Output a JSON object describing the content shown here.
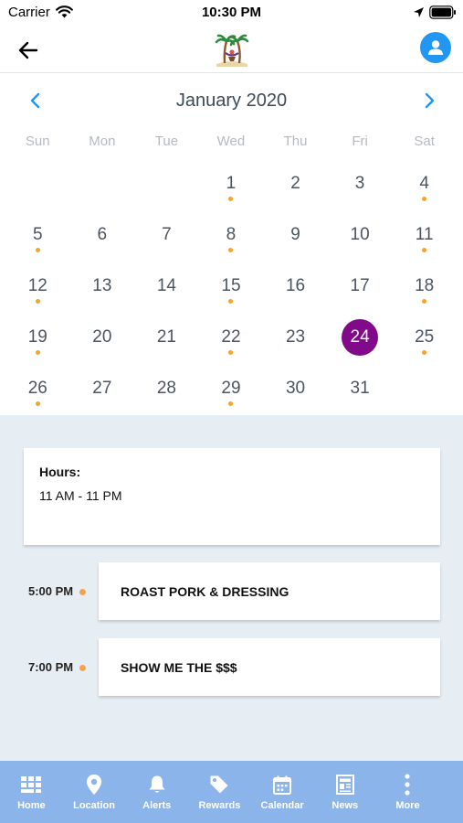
{
  "status_bar": {
    "carrier": "Carrier",
    "time": "10:30 PM"
  },
  "calendar": {
    "month_title": "January 2020",
    "weekdays": [
      "Sun",
      "Mon",
      "Tue",
      "Wed",
      "Thu",
      "Fri",
      "Sat"
    ],
    "weeks": [
      [
        null,
        null,
        null,
        {
          "day": "1",
          "dot": true
        },
        {
          "day": "2",
          "dot": false
        },
        {
          "day": "3",
          "dot": false
        },
        {
          "day": "4",
          "dot": true
        }
      ],
      [
        {
          "day": "5",
          "dot": true
        },
        {
          "day": "6",
          "dot": false
        },
        {
          "day": "7",
          "dot": false
        },
        {
          "day": "8",
          "dot": true
        },
        {
          "day": "9",
          "dot": false
        },
        {
          "day": "10",
          "dot": false
        },
        {
          "day": "11",
          "dot": true
        }
      ],
      [
        {
          "day": "12",
          "dot": true
        },
        {
          "day": "13",
          "dot": false
        },
        {
          "day": "14",
          "dot": false
        },
        {
          "day": "15",
          "dot": true
        },
        {
          "day": "16",
          "dot": false
        },
        {
          "day": "17",
          "dot": false
        },
        {
          "day": "18",
          "dot": true
        }
      ],
      [
        {
          "day": "19",
          "dot": true
        },
        {
          "day": "20",
          "dot": false
        },
        {
          "day": "21",
          "dot": false
        },
        {
          "day": "22",
          "dot": true
        },
        {
          "day": "23",
          "dot": false
        },
        {
          "day": "24",
          "dot": false,
          "selected": true
        },
        {
          "day": "25",
          "dot": true
        }
      ],
      [
        {
          "day": "26",
          "dot": true
        },
        {
          "day": "27",
          "dot": false
        },
        {
          "day": "28",
          "dot": false
        },
        {
          "day": "29",
          "dot": true
        },
        {
          "day": "30",
          "dot": false
        },
        {
          "day": "31",
          "dot": false
        },
        null
      ]
    ],
    "selected_day": "24"
  },
  "hours": {
    "label": "Hours:",
    "value": "11 AM - 11 PM"
  },
  "events": [
    {
      "time": "5:00 PM",
      "title": "ROAST PORK & DRESSING"
    },
    {
      "time": "7:00 PM",
      "title": "SHOW ME THE $$$"
    }
  ],
  "tab_bar": {
    "items": [
      {
        "label": "Home",
        "icon": "grid-icon"
      },
      {
        "label": "Location",
        "icon": "map-pin-icon"
      },
      {
        "label": "Alerts",
        "icon": "bell-icon"
      },
      {
        "label": "Rewards",
        "icon": "tag-icon"
      },
      {
        "label": "Calendar",
        "icon": "calendar-icon"
      },
      {
        "label": "News",
        "icon": "newspaper-icon"
      },
      {
        "label": "More",
        "icon": "more-dots-icon"
      }
    ]
  },
  "colors": {
    "accent_blue": "#2196f3",
    "selected_day": "#800a8a",
    "event_dot": "#f5a623",
    "panel_background": "#e7eef3",
    "tab_bar": "#8ab4ea"
  }
}
